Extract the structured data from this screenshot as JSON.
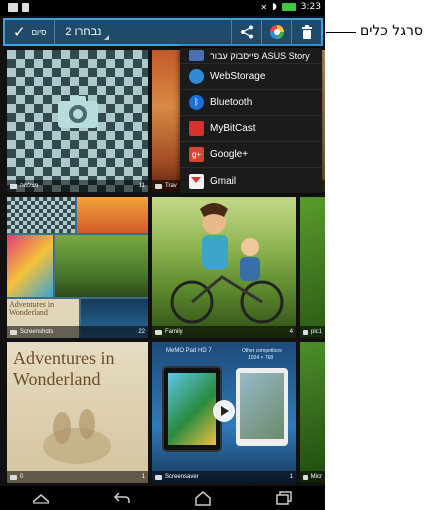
{
  "status_bar": {
    "time": "3:23"
  },
  "toolbar": {
    "done_label": "סיום",
    "done_icon": "check-icon",
    "selection_count": "2 נבחרו",
    "actions": [
      {
        "name": "share-icon"
      },
      {
        "name": "color-wheel-icon"
      },
      {
        "name": "delete-icon"
      }
    ]
  },
  "share_menu": {
    "items": [
      {
        "label": "פייסבוק עבור ASUS Story",
        "icon": "asus-story-icon",
        "color": "#4a6fb5"
      },
      {
        "label": "WebStorage",
        "icon": "webstorage-icon",
        "color": "#2f8bd8"
      },
      {
        "label": "Bluetooth",
        "icon": "bluetooth-icon",
        "color": "#1b6fd6"
      },
      {
        "label": "MyBitCast",
        "icon": "mybitcast-icon",
        "color": "#d6312a"
      },
      {
        "label": "Google+",
        "icon": "google-plus-icon",
        "color": "#d64533"
      },
      {
        "label": "Gmail",
        "icon": "gmail-icon",
        "color": "#e8e8e8"
      }
    ]
  },
  "albums": {
    "camera": {
      "name": "מצלמה",
      "count": "11"
    },
    "travel": {
      "name": "Trav"
    },
    "travel_count": "2",
    "screenshots": {
      "name": "Screenshots",
      "count": "22"
    },
    "family": {
      "name": "Family",
      "count": "4"
    },
    "pic": {
      "name": "pic1"
    },
    "zero": {
      "name": "0",
      "count": "1"
    },
    "screensaver": {
      "name": "Screensaver",
      "count": "1"
    },
    "mic": {
      "name": "Micr"
    }
  },
  "covers": {
    "wonderland_text": "Adventures in Wonderland",
    "mini_wonderland_text": "Adventures in Wonderland"
  },
  "screensaver_art": {
    "device_label": "MeMO Pad HD 7",
    "competitor_label": "Other competitors",
    "competitor_res": "1024 × 768"
  },
  "navigation": {
    "buttons": [
      "home-up-icon",
      "back-icon",
      "home-icon",
      "recent-apps-icon"
    ]
  },
  "callout": {
    "label": "סרגל כלים"
  },
  "colors": {
    "toolbar_bg": "#1f4a69",
    "toolbar_border": "#3da2e0",
    "menu_bg": "#1b1b1b"
  }
}
